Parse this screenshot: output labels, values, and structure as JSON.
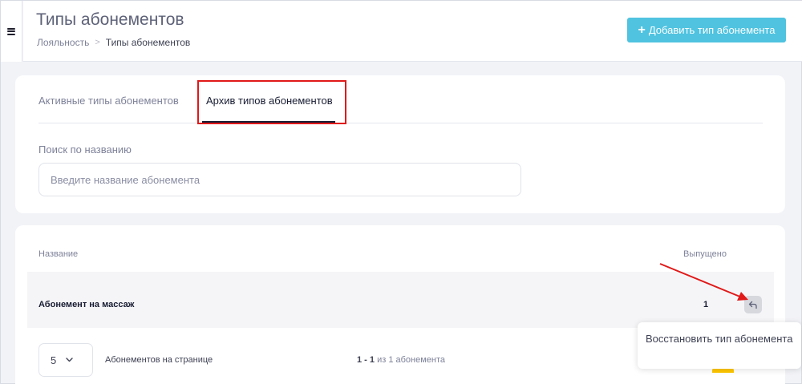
{
  "header": {
    "title": "Типы абонементов",
    "breadcrumb": [
      "Лояльность",
      "Типы абонементов"
    ],
    "breadcrumb_separator": ">",
    "add_button_label": "Добавить тип абонемента",
    "add_button_icon": "plus-icon"
  },
  "tabs": [
    {
      "label": "Активные типы абонементов",
      "active": false
    },
    {
      "label": "Архив типов абонементов",
      "active": true
    }
  ],
  "search": {
    "label": "Поиск по названию",
    "placeholder": "Введите название абонемента",
    "value": ""
  },
  "table": {
    "columns": [
      "Название",
      "Выпущено"
    ],
    "rows": [
      {
        "name": "Абонемент на массаж",
        "issued": "1",
        "action_icon": "restore-icon"
      }
    ]
  },
  "pagination": {
    "page_size": "5",
    "page_size_label": "Абонементов на странице",
    "range": "1 - 1",
    "of_text": "из 1 абонемента"
  },
  "tooltip": {
    "text": "Восстановить тип абонемента"
  },
  "colors": {
    "accent": "#4fc3e0",
    "annotation": "#e01919",
    "warning": "#ffc700"
  }
}
